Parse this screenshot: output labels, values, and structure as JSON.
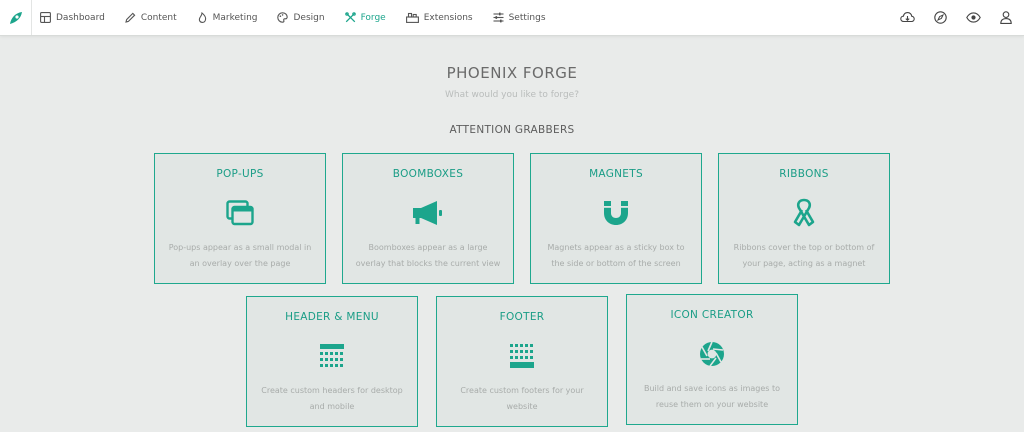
{
  "nav": {
    "items": [
      {
        "label": "Dashboard",
        "icon": "dashboard-icon"
      },
      {
        "label": "Content",
        "icon": "pencil-icon"
      },
      {
        "label": "Marketing",
        "icon": "flame-icon"
      },
      {
        "label": "Design",
        "icon": "palette-icon"
      },
      {
        "label": "Forge",
        "icon": "tools-icon",
        "active": true
      },
      {
        "label": "Extensions",
        "icon": "extensions-icon"
      },
      {
        "label": "Settings",
        "icon": "sliders-icon"
      }
    ]
  },
  "header": {
    "title": "PHOENIX FORGE",
    "subtitle": "What would you like to forge?",
    "section": "ATTENTION GRABBERS"
  },
  "cards": [
    {
      "title": "POP-UPS",
      "icon": "windows-icon",
      "desc": "Pop-ups appear as a small modal in an overlay over the page"
    },
    {
      "title": "BOOMBOXES",
      "icon": "megaphone-icon",
      "desc": "Boomboxes appear as a large overlay that blocks the current view"
    },
    {
      "title": "MAGNETS",
      "icon": "magnet-icon",
      "desc": "Magnets appear as a sticky box to the side or bottom of the screen"
    },
    {
      "title": "RIBBONS",
      "icon": "ribbon-icon",
      "desc": "Ribbons cover the top or bottom of your page, acting as a magnet"
    },
    {
      "title": "HEADER & MENU",
      "icon": "header-grid-icon",
      "desc": "Create custom headers for desktop and mobile"
    },
    {
      "title": "FOOTER",
      "icon": "footer-grid-icon",
      "desc": "Create custom footers for your website"
    },
    {
      "title": "ICON CREATOR",
      "icon": "aperture-icon",
      "desc": "Build and save icons as images to reuse them on your website"
    }
  ],
  "colors": {
    "accent": "#1ca58c",
    "background": "#e9ebea",
    "card": "#e1e6e4"
  }
}
